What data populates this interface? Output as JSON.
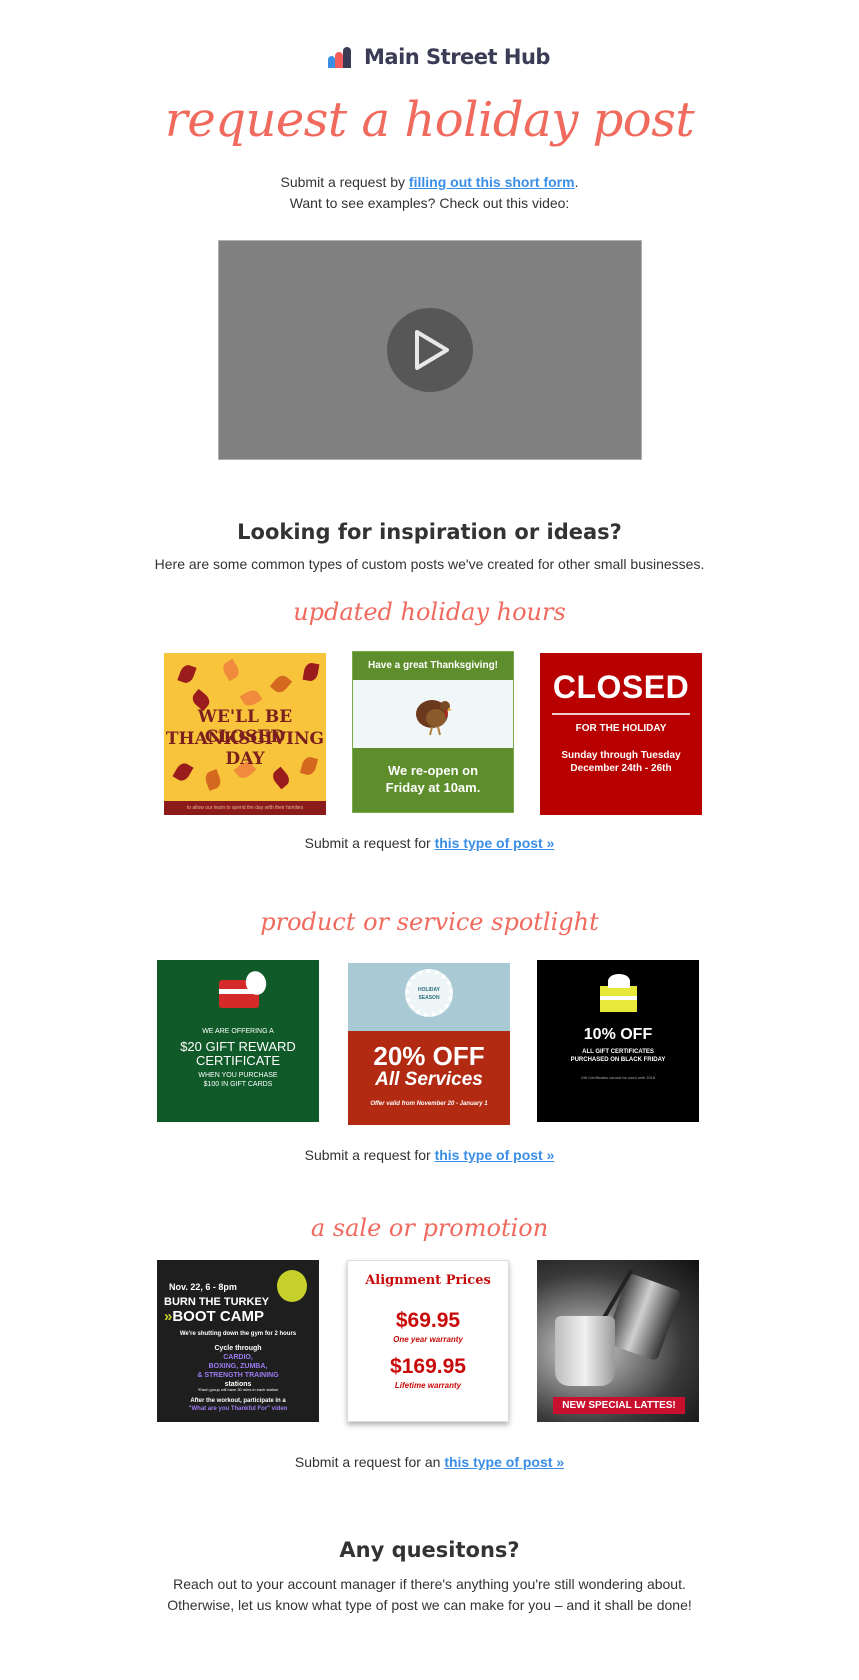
{
  "brand": {
    "name": "Main Street Hub"
  },
  "headline": "request a holiday post",
  "intro": {
    "line1_prefix": "Submit a request by ",
    "line1_link": "filling out this short form",
    "line1_suffix": ".",
    "line2": "Want to see examples? Check out this video:"
  },
  "video": {
    "icon": "play-icon"
  },
  "inspiration": {
    "title": "Looking for inspiration or ideas?",
    "subtitle": "Here are some common types of custom posts we've created for other small businesses."
  },
  "sections": [
    {
      "title": "updated holiday hours",
      "request_prefix": "Submit a request for ",
      "request_link": "this type of post »",
      "images": [
        {
          "line1": "WE'LL BE CLOSED",
          "line2": "THANKSGIVING DAY",
          "footer": "to allow our team to spend the day with their families"
        },
        {
          "top": "Have a great Thanksgiving!",
          "bottom1": "We re-open on",
          "bottom2": "Friday at 10am."
        },
        {
          "big": "CLOSED",
          "mid": "FOR THE HOLIDAY",
          "low1": "Sunday through Tuesday",
          "low2": "December 24th - 26th"
        }
      ]
    },
    {
      "title": "product or service spotlight",
      "request_prefix": "Submit a request for ",
      "request_link": "this type of post »",
      "images": [
        {
          "s1": "WE ARE OFFERING A",
          "s2a": "$20 GIFT REWARD",
          "s2b": "CERTIFICATE",
          "s3a": "WHEN YOU PURCHASE",
          "s3b": "$100 IN GIFT CARDS"
        },
        {
          "w1": "HOLIDAY",
          "w2": "SEASON",
          "p1": "20% OFF",
          "p2": "All Services",
          "p3": "Offer valid from November 20 - January 1"
        },
        {
          "o1": "10% OFF",
          "o2a": "ALL GIFT CERTIFICATES",
          "o2b": "PURCHASED ON BLACK FRIDAY",
          "o3": "Gift Certificates cannot be used until 2018"
        }
      ]
    },
    {
      "title": "a sale or promotion",
      "request_prefix": "Submit a request for an ",
      "request_link": "this type of post »",
      "images": [
        {
          "b1": "Nov. 22, 6 - 8pm",
          "b2": "BURN THE TURKEY",
          "b3": "BOOT CAMP",
          "b4": "We're shutting down the gym for 2 hours",
          "b5a": "Cycle through",
          "b5b": "CARDIO,",
          "b5c": "BOXING, ZUMBA,",
          "b5d": "& STRENGTH TRAINING",
          "b5e": "stations",
          "b6": "*Each group will have 30 mins in each station",
          "b7a": "After the workout, participate in a",
          "b7b": "\"What are you Thankful For\" video"
        },
        {
          "a1": "Alignment Prices",
          "a2": "$69.95",
          "a3": "One year warranty",
          "a4": "$169.95",
          "a5": "Lifetime warranty"
        },
        {
          "tag": "NEW SPECIAL LATTES!"
        }
      ]
    }
  ],
  "questions": {
    "title": "Any quesitons?",
    "line1": "Reach out to your account manager if there's anything you're still wondering about.",
    "line2": "Otherwise, let us know what type of post we can make for you – and it shall be done!"
  },
  "colors": {
    "accent": "#f16a5e",
    "link": "#3a8ee6",
    "text": "#333333"
  }
}
